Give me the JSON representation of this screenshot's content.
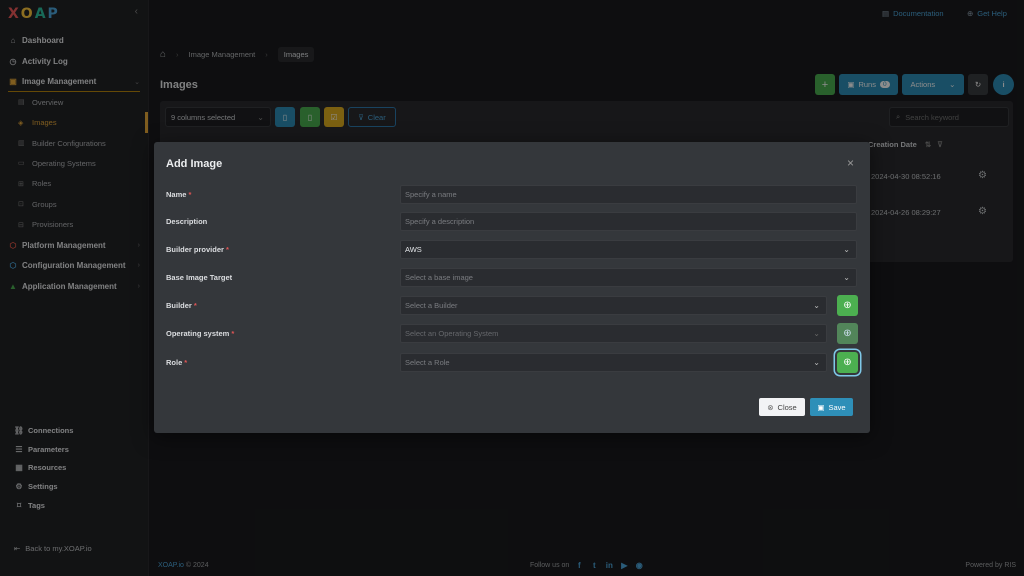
{
  "app": {
    "logo_letters": [
      "X",
      "O",
      "A",
      "P"
    ],
    "logo_colors": [
      "#f15a5a",
      "#ffc83d",
      "#2dc1a0",
      "#4ea8de"
    ]
  },
  "sidebar": {
    "collapse_icon": "chevron-left-icon",
    "items": [
      {
        "label": "Dashboard",
        "icon": "home-icon"
      },
      {
        "label": "Activity Log",
        "icon": "clock-icon"
      },
      {
        "label": "Image Management",
        "icon": "image-icon"
      }
    ],
    "image_management_children": [
      {
        "label": "Overview"
      },
      {
        "label": "Images"
      },
      {
        "label": "Builder Configurations"
      },
      {
        "label": "Operating Systems"
      },
      {
        "label": "Roles"
      },
      {
        "label": "Groups"
      },
      {
        "label": "Provisioners"
      }
    ],
    "sections": [
      {
        "label": "Platform Management",
        "color": "#e85a4a"
      },
      {
        "label": "Configuration Management",
        "color": "#4ea8de"
      },
      {
        "label": "Application Management",
        "color": "#4caf50"
      }
    ],
    "bottom": [
      {
        "label": "Connections"
      },
      {
        "label": "Parameters"
      },
      {
        "label": "Resources"
      },
      {
        "label": "Settings"
      },
      {
        "label": "Tags"
      }
    ],
    "back_link": "Back to my.XOAP.io"
  },
  "topbar": {
    "documentation": "Documentation",
    "get_help": "Get Help"
  },
  "breadcrumb": {
    "section": "Image Management",
    "current": "Images"
  },
  "page": {
    "title": "Images",
    "runs_label": "Runs",
    "runs_count": "0",
    "actions_label": "Actions"
  },
  "grid": {
    "columns_selected": "9 columns selected",
    "clear_label": "Clear",
    "search_placeholder": "Search keyword",
    "creation_date_header": "Creation Date",
    "rows": [
      {
        "creation_date": "2024-04-30 08:52:16"
      },
      {
        "creation_date": "2024-04-26 08:29:27"
      }
    ]
  },
  "modal": {
    "title": "Add Image",
    "fields": {
      "name": {
        "label": "Name",
        "placeholder": "Specify a name"
      },
      "description": {
        "label": "Description",
        "placeholder": "Specify a description"
      },
      "builder_provider": {
        "label": "Builder provider",
        "value": "AWS"
      },
      "base_image_target": {
        "label": "Base Image Target",
        "placeholder": "Select a base image"
      },
      "builder": {
        "label": "Builder",
        "placeholder": "Select a Builder"
      },
      "operating_system": {
        "label": "Operating system",
        "placeholder": "Select an Operating System"
      },
      "role": {
        "label": "Role",
        "placeholder": "Select a Role"
      }
    },
    "required_mark": "*",
    "close_label": "Close",
    "save_label": "Save"
  },
  "footer": {
    "brand": "XOAP.io",
    "copyright": "© 2024",
    "follow_label": "Follow us on",
    "powered_by": "Powered by RIS"
  }
}
